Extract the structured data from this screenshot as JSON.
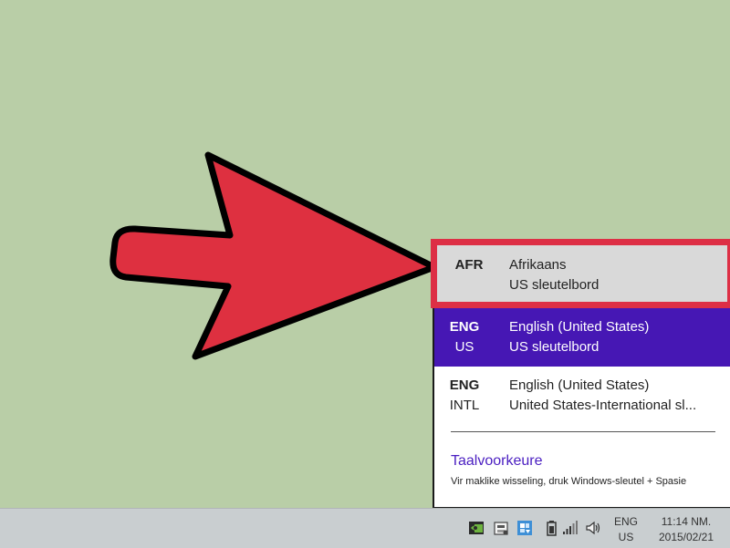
{
  "language_flyout": {
    "items": [
      {
        "code_line1": "AFR",
        "code_line2": "",
        "name_line1": "Afrikaans",
        "name_line2": "US sleutelbord",
        "state": "highlighted"
      },
      {
        "code_line1": "ENG",
        "code_line2": "US",
        "name_line1": "English (United States)",
        "name_line2": "US sleutelbord",
        "state": "selected"
      },
      {
        "code_line1": "ENG",
        "code_line2": "INTL",
        "name_line1": "English (United States)",
        "name_line2": "United States-International sl...",
        "state": "normal"
      }
    ],
    "preferences_link": "Taalvoorkeure",
    "hint": "Vir maklike wisseling, druk Windows-sleutel + Spasie"
  },
  "taskbar": {
    "tray_icons": [
      "nvidia-icon",
      "network-drive-icon",
      "update-icon",
      "battery-icon",
      "signal-icon",
      "volume-icon"
    ],
    "language_indicator": {
      "line1": "ENG",
      "line2": "US"
    },
    "clock": {
      "time": "11:14 NM.",
      "date": "2015/02/21"
    }
  },
  "colors": {
    "desktop": "#b9cea7",
    "selected_item": "#4617b4",
    "highlight_border": "#dd2f45",
    "arrow_fill": "#de3040"
  }
}
